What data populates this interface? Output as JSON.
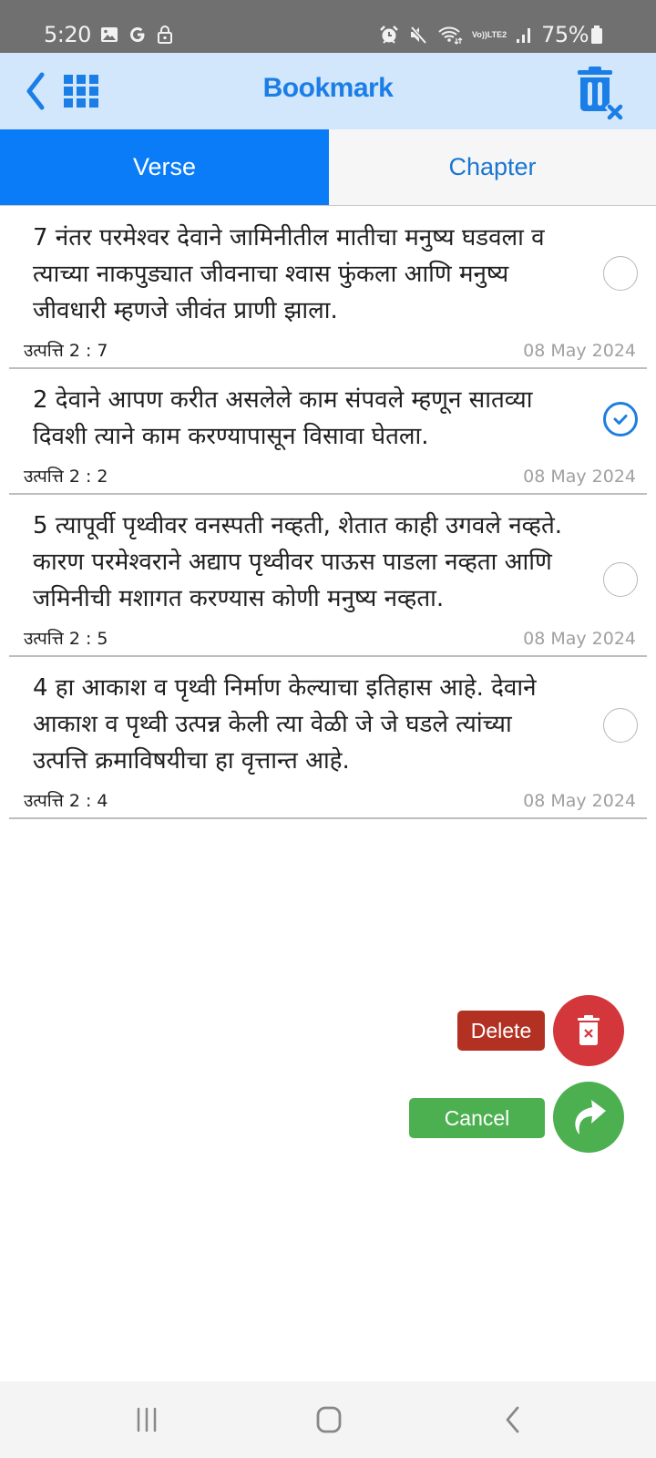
{
  "status_bar": {
    "time": "5:20",
    "left_icons": [
      "gallery-icon",
      "google-icon",
      "lock-icon"
    ],
    "right_icons": [
      "alarm-icon",
      "mute-icon",
      "wifi-icon",
      "volte-lte2-icon",
      "signal-icon"
    ],
    "lte_top": "Vo))",
    "lte_bottom": "LTE2",
    "battery_percent": "75%"
  },
  "header": {
    "title": "Bookmark",
    "back_icon": "chevron-left-icon",
    "grid_icon": "grid-icon",
    "delete_all_icon": "trash-x-icon"
  },
  "tabs": [
    {
      "label": "Verse",
      "active": true
    },
    {
      "label": "Chapter",
      "active": false
    }
  ],
  "bookmarks": [
    {
      "text": "7  नंतर परमेश्वर देवाने जामिनीतील मातीचा मनुष्य घडवला व त्याच्या नाकपुड्यात जीवनाचा श्वास फुंकला आणि मनुष्य जीवधारी म्हणजे जीवंत प्राणी झाला.",
      "reference": "उत्पत्ति 2 : 7",
      "date": "08 May 2024",
      "selected": false
    },
    {
      "text": "2  देवाने आपण करीत असलेले काम संपवले म्हणून सातव्या दिवशी त्याने काम करण्यापासून विसावा घेतला.",
      "reference": "उत्पत्ति 2 : 2",
      "date": "08 May 2024",
      "selected": true
    },
    {
      "text": "5  त्यापूर्वी पृथ्वीवर वनस्पती नव्हती, शेतात काही उगवले नव्हते. कारण परमेश्वराने अद्याप पृथ्वीवर पाऊस पाडला नव्हता आणि जमिनीची मशागत करण्यास कोणी मनुष्य नव्हता.",
      "reference": "उत्पत्ति 2 : 5",
      "date": "08 May 2024",
      "selected": false
    },
    {
      "text": "4  हा आकाश व पृथ्वी निर्माण केल्याचा इतिहास आहे. देवाने आकाश व पृथ्वी उत्पन्न केली त्या वेळी जे जे घडले त्यांच्या उत्पत्ति क्रमाविषयीचा हा वृत्तान्त आहे.",
      "reference": "उत्पत्ति 2 : 4",
      "date": "08 May 2024",
      "selected": false
    }
  ],
  "actions": {
    "delete_label": "Delete",
    "cancel_label": "Cancel",
    "delete_color": "#d4373b",
    "delete_label_color": "#b33122",
    "cancel_color": "#4caf50"
  },
  "colors": {
    "accent": "#0a7cf8",
    "header_bg": "#d2e6fc",
    "title": "#1a7ee6"
  },
  "nav_bar": {
    "buttons": [
      "recent-apps-icon",
      "home-icon",
      "back-icon"
    ]
  }
}
